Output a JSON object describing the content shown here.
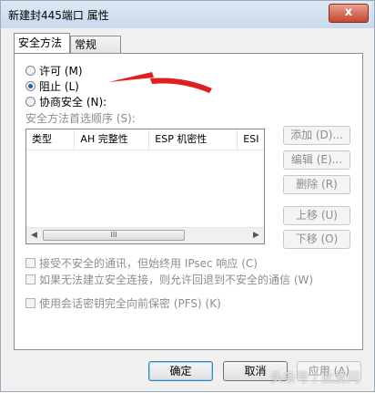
{
  "window": {
    "title": "新建封445端口 属性",
    "close_glyph": "x"
  },
  "tabs": [
    {
      "label": "安全方法"
    },
    {
      "label": "常规"
    }
  ],
  "radios": [
    {
      "label": "许可 (M)",
      "checked": false
    },
    {
      "label": "阻止 (L)",
      "checked": true
    },
    {
      "label": "协商安全 (N):",
      "checked": false
    }
  ],
  "list": {
    "caption": "安全方法首选顺序 (S):",
    "columns": [
      "类型",
      "AH 完整性",
      "ESP 机密性",
      "ESI"
    ],
    "rows": [],
    "scroll_left": "◀",
    "scroll_right": "▶",
    "scroll_grip": "III"
  },
  "side_buttons": [
    {
      "label": "添加 (D)..."
    },
    {
      "label": "编辑 (E)..."
    },
    {
      "label": "删除 (R)"
    },
    {
      "label": "上移 (U)"
    },
    {
      "label": "下移 (O)"
    }
  ],
  "checkboxes": [
    {
      "label": "接受不安全的通讯，但始终用 IPsec 响应 (C)",
      "checked": false
    },
    {
      "label": "如果无法建立安全连接，则允许回退到不安全的通信 (W)",
      "checked": false
    },
    {
      "label": "使用会话密钥完全向前保密 (PFS) (K)",
      "checked": false
    }
  ],
  "footer": {
    "ok": "确定",
    "cancel": "取消",
    "apply": "应用 (A)"
  },
  "watermark": "头条号 / 此爱问",
  "colors": {
    "annotation_arrow": "#e02020",
    "accent": "#3c7fb1"
  }
}
